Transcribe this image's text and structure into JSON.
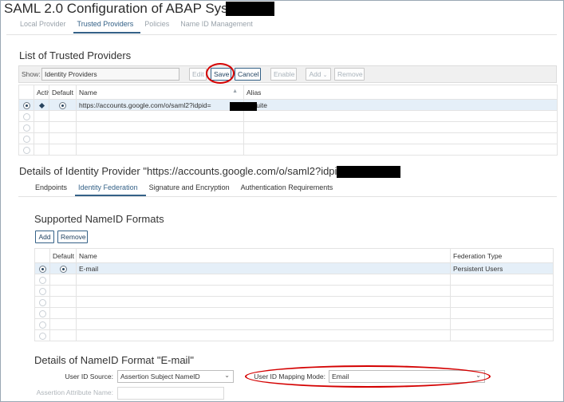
{
  "window": {
    "title": "SAML 2.0 Configuration of ABAP System:"
  },
  "main_tabs": [
    {
      "label": "Local Provider"
    },
    {
      "label": "Trusted Providers"
    },
    {
      "label": "Policies"
    },
    {
      "label": "Name ID Management"
    }
  ],
  "trusted": {
    "heading": "List of Trusted Providers",
    "show_label": "Show:",
    "show_value": "Identity Providers",
    "buttons": {
      "edit": "Edit",
      "save": "Save",
      "cancel": "Cancel",
      "enable": "Enable",
      "add": "Add",
      "remove": "Remove"
    },
    "columns": {
      "active": "Active",
      "default": "Default",
      "name": "Name",
      "alias": "Alias"
    },
    "rows": [
      {
        "name": "https://accounts.google.com/o/saml2?idpid=",
        "alias": "GSuite"
      }
    ]
  },
  "details": {
    "heading": "Details of Identity Provider \"https://accounts.google.com/o/saml2?idpid=",
    "tabs": [
      {
        "label": "Endpoints"
      },
      {
        "label": "Identity Federation"
      },
      {
        "label": "Signature and Encryption"
      },
      {
        "label": "Authentication Requirements"
      }
    ]
  },
  "nameid": {
    "heading": "Supported NameID Formats",
    "add": "Add",
    "remove": "Remove",
    "columns": {
      "default": "Default",
      "name": "Name",
      "federation_type": "Federation Type"
    },
    "rows": [
      {
        "name": "E-mail",
        "federation_type": "Persistent Users"
      }
    ]
  },
  "format_details": {
    "heading": "Details of NameID Format \"E-mail\"",
    "user_id_source_label": "User ID Source:",
    "user_id_source_value": "Assertion Subject NameID",
    "mapping_mode_label": "User ID Mapping Mode:",
    "mapping_mode_value": "Email",
    "assertion_attr_label": "Assertion Attribute Name:",
    "assertion_attr_value": ""
  },
  "colors": {
    "accent": "#346187",
    "highlight": "#d40000",
    "selected_row": "#e5eff8"
  }
}
